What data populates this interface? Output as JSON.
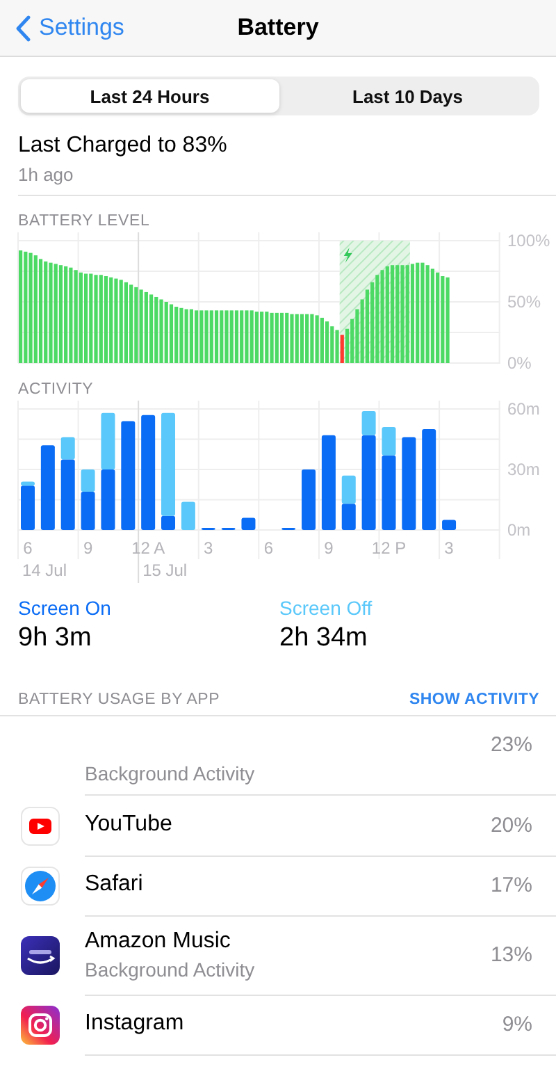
{
  "nav": {
    "back": "Settings",
    "title": "Battery"
  },
  "tabs": [
    {
      "label": "Last 24 Hours",
      "selected": true
    },
    {
      "label": "Last 10 Days",
      "selected": false
    }
  ],
  "last_charged": {
    "title": "Last Charged to 83%",
    "time": "1h ago"
  },
  "battery_chart": {
    "chart_data": {
      "type": "bar",
      "title": "BATTERY LEVEL",
      "stacked": true,
      "ylim": [
        0,
        100
      ],
      "yticks": [
        {
          "value": 0,
          "label": "0%"
        },
        {
          "value": 50,
          "label": "50%"
        },
        {
          "value": 100,
          "label": "100%"
        }
      ],
      "series": [
        {
          "color": "#4cd964",
          "values": [
            92,
            91,
            90,
            88,
            85,
            83,
            82,
            81,
            80,
            79,
            78,
            76,
            74,
            73,
            73,
            72,
            72,
            71,
            70,
            69,
            68,
            66,
            64,
            62,
            60,
            58,
            56,
            54,
            52,
            50,
            48,
            46,
            45,
            44,
            44,
            43,
            43,
            43,
            43,
            43,
            43,
            43,
            43,
            43,
            43,
            43,
            43,
            42,
            42,
            42,
            41,
            41,
            41,
            41,
            40,
            40,
            40,
            40,
            40,
            39,
            37,
            34,
            30,
            27,
            null,
            28,
            36,
            44,
            52,
            60,
            66,
            72,
            76,
            79,
            80,
            80,
            80,
            80,
            81,
            82,
            82,
            80,
            77,
            74,
            71,
            70,
            null,
            null,
            null,
            null,
            null,
            null,
            null,
            null,
            null,
            null
          ]
        },
        {
          "color": "#ff3b30",
          "values": [
            null,
            null,
            null,
            null,
            null,
            null,
            null,
            null,
            null,
            null,
            null,
            null,
            null,
            null,
            null,
            null,
            null,
            null,
            null,
            null,
            null,
            null,
            null,
            null,
            null,
            null,
            null,
            null,
            null,
            null,
            null,
            null,
            null,
            null,
            null,
            null,
            null,
            null,
            null,
            null,
            null,
            null,
            null,
            null,
            null,
            null,
            null,
            null,
            null,
            null,
            null,
            null,
            null,
            null,
            null,
            null,
            null,
            null,
            null,
            null,
            null,
            null,
            null,
            null,
            23,
            null,
            null,
            null,
            null,
            null,
            null,
            null,
            null,
            null,
            null,
            null,
            null,
            null,
            null,
            null,
            null,
            null,
            null,
            null,
            null,
            null,
            null,
            null,
            null,
            null,
            null,
            null,
            null,
            null,
            null,
            null
          ]
        }
      ]
    }
  },
  "activity_chart": {
    "chart_data": {
      "type": "bar",
      "title": "ACTIVITY",
      "stacked": true,
      "ylim": [
        0,
        60
      ],
      "yticks": [
        {
          "value": 0,
          "label": "0m"
        },
        {
          "value": 30,
          "label": "30m"
        },
        {
          "value": 60,
          "label": "60m"
        }
      ],
      "categories": [
        "6",
        null,
        null,
        "9",
        null,
        null,
        "12 A",
        null,
        null,
        "3",
        null,
        null,
        "6",
        null,
        null,
        "9",
        null,
        null,
        "12 P",
        null,
        null,
        "3"
      ],
      "series": [
        {
          "name": "Screen On",
          "color": "#0a6cf5",
          "values": [
            22,
            42,
            35,
            19,
            30,
            54,
            57,
            7,
            0,
            1,
            1,
            6,
            0,
            1,
            30,
            47,
            13,
            47,
            37,
            46,
            50,
            5
          ]
        },
        {
          "name": "Screen Off",
          "color": "#5ac8fa",
          "values": [
            2,
            0,
            11,
            11,
            28,
            0,
            0,
            51,
            14,
            0,
            0,
            0,
            0,
            0,
            0,
            0,
            14,
            12,
            14,
            0,
            0,
            0
          ]
        }
      ],
      "annotations": [
        "14 Jul",
        "15 Jul"
      ]
    }
  },
  "screen_totals": [
    {
      "value": "9h 3m"
    },
    {
      "value": "2h 34m"
    }
  ],
  "usage": {
    "title": "BATTERY USAGE BY APP",
    "action": "SHOW ACTIVITY"
  },
  "apps": [
    {
      "subtitle": "Background Activity",
      "percent": "23%"
    },
    {
      "kind": "youtube",
      "name": "YouTube",
      "percent": "20%"
    },
    {
      "kind": "safari",
      "name": "Safari",
      "percent": "17%"
    },
    {
      "kind": "amazon-music",
      "name": "Amazon Music",
      "subtitle": "Background Activity",
      "percent": "13%"
    },
    {
      "kind": "instagram",
      "name": "Instagram",
      "percent": "9%"
    }
  ]
}
